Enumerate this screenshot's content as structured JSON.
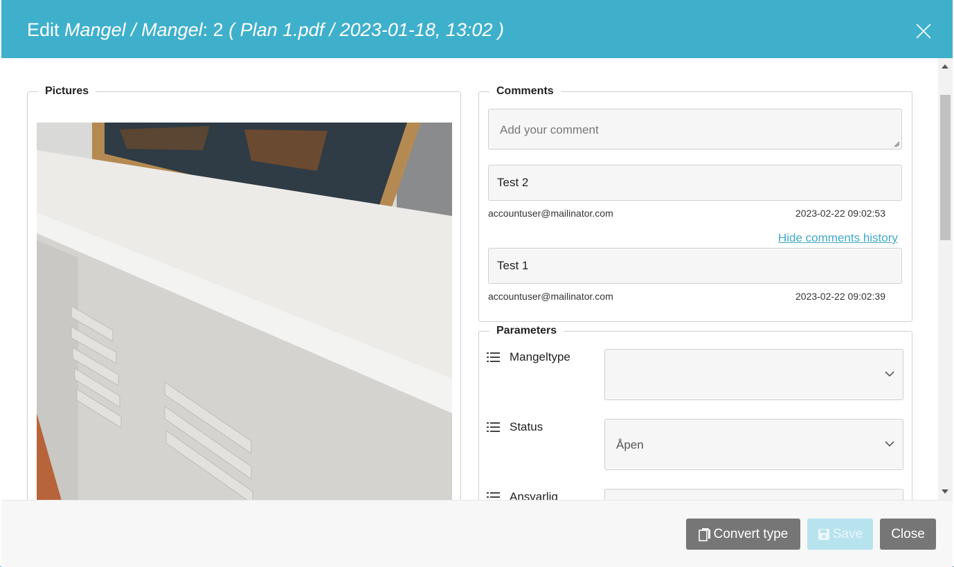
{
  "header": {
    "title_prefix": "Edit ",
    "title_italic_1": "Mangel / Mangel",
    "title_middle": ": 2 ",
    "title_italic_2": "( Plan 1.pdf / 2023-01-18, 13:02 )",
    "close_icon": "close-icon"
  },
  "pictures": {
    "legend": "Pictures"
  },
  "comments": {
    "legend": "Comments",
    "input_placeholder": "Add your comment",
    "items": [
      {
        "text": "Test 2",
        "user": "accountuser@mailinator.com",
        "time": "2023-02-22 09:02:53"
      },
      {
        "text": "Test 1",
        "user": "accountuser@mailinator.com",
        "time": "2023-02-22 09:02:39"
      }
    ],
    "hide_history_label": "Hide comments history"
  },
  "parameters": {
    "legend": "Parameters",
    "rows": [
      {
        "label": "Mangeltype",
        "value": ""
      },
      {
        "label": "Status",
        "value": "Åpen"
      },
      {
        "label": "Ansvarlig",
        "value": ""
      }
    ]
  },
  "footer": {
    "convert_label": "Convert type",
    "save_label": "Save",
    "close_label": "Close"
  },
  "colors": {
    "header": "#3fb0cb",
    "link": "#3fa8c6",
    "button_gray": "#767676",
    "button_save_disabled": "#b7e3ee"
  }
}
